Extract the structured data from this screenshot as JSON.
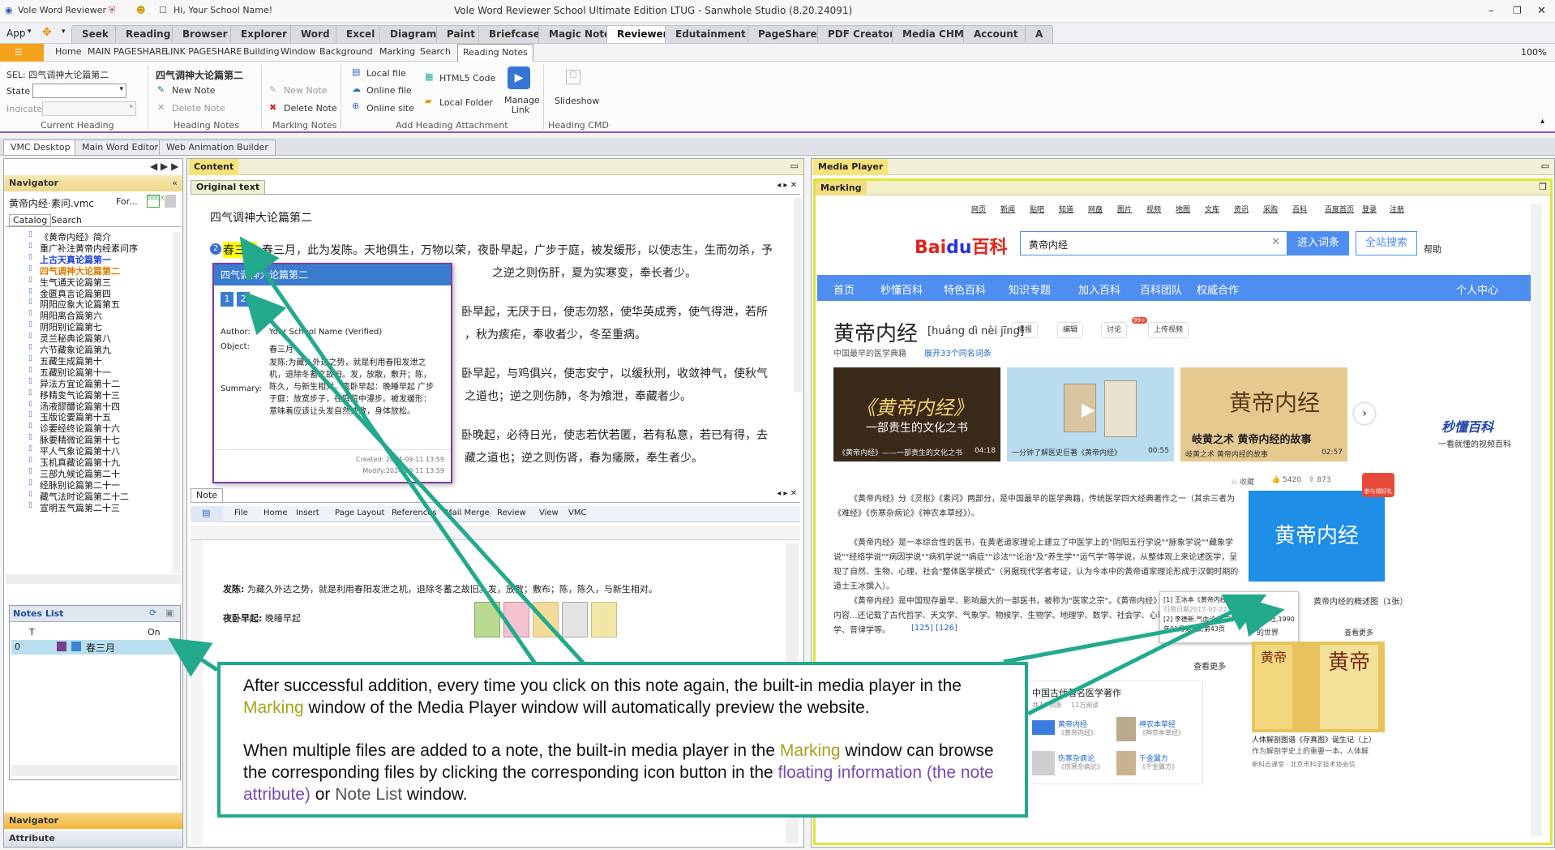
{
  "titlebar": {
    "app_name": "Vole Word Reviewer",
    "greeting": "Hi, Your School Name!",
    "title": "Vole Word Reviewer School Ultimate Edition LTUG - Sanwhole Studio (8.20.24091)"
  },
  "app_menu": "App",
  "ribbon_tabs": [
    "Seek",
    "Reading",
    "Browser",
    "Explorer",
    "Word",
    "Excel",
    "Diagram",
    "Paint",
    "Briefcase",
    "Magic Note",
    "Reviewer",
    "Edutainment",
    "PageShare",
    "PDF Creator",
    "Media CHM",
    "Account",
    "A"
  ],
  "active_tab": "Reviewer",
  "sub_tabs": [
    "Home",
    "MAIN PAGESHARE",
    "LINK PAGESHARE",
    "Building",
    "Window",
    "Background",
    "Marking",
    "Search",
    "Reading Notes"
  ],
  "zoom": "100%",
  "ribbon": {
    "sel_label": "SEL: 四气调神大论篇第二",
    "state_label": "State",
    "indicate_label": "Indicate",
    "group_current_heading": "Current Heading",
    "heading_title": "四气调神大论篇第二",
    "new_note": "New Note",
    "delete_note": "Delete Note",
    "group_heading_notes": "Heading Notes",
    "new_note2": "New Note",
    "delete_note2": "Delete Note",
    "group_marking_notes": "Marking Notes",
    "local_file": "Local file",
    "online_file": "Online file",
    "online_site": "Online site",
    "html5_code": "HTML5 Code",
    "local_folder": "Local Folder",
    "manage_link": "Manage Link",
    "group_add_attachment": "Add Heading Attachment",
    "slideshow": "Slideshow",
    "group_heading_cmd": "Heading CMD"
  },
  "panel_tabs": [
    "VMC Desktop",
    "Main Word Editor",
    "Web Animation Builder"
  ],
  "navigator": {
    "title": "Navigator",
    "file": "黄帝内经·素问.vmc",
    "file_extra": "For...",
    "tabs": [
      "Catalog",
      "Search"
    ],
    "items": [
      "《黄帝内经》简介",
      "重广补注黄帝内经素问序",
      "上古天真论篇第一",
      "四气调神大论篇第二",
      "生气通天论篇第三",
      "金匮真言论篇第四",
      "阴阳应象大论篇第五",
      "阴阳离合篇第六",
      "阴阳别论篇第七",
      "灵兰秘典论篇第八",
      "六节藏象论篇第九",
      "五藏生成篇第十",
      "五藏别论篇第十一",
      "异法方宜论篇第十二",
      "移精变气论篇第十三",
      "汤液醪醴论篇第十四",
      "玉版论要篇第十五",
      "诊要经终论篇第十六",
      "脉要精微论篇第十七",
      "平人气象论篇第十八",
      "玉机真藏论篇第十九",
      "三部九候论篇第二十",
      "经脉别论篇第二十一",
      "藏气法时论篇第二十二",
      "宣明五气篇第二十三"
    ]
  },
  "notes_list": {
    "title": "Notes List",
    "col_t": "T",
    "col_on": "On",
    "row_index": "0",
    "row_label": "春三月"
  },
  "bottom_bars": [
    "Navigator",
    "Attribute"
  ],
  "content": {
    "title": "Content",
    "original_tab": "Original text",
    "heading": "四气调神大论篇第二",
    "paragraphs": [
      "春三月，此为发陈。天地俱生，万物以荣，夜卧早起，广步于庭，被发缓形，以使志生，生而勿杀，予",
      "之逆之则伤肝，夏为实寒变，奉长者少。",
      "卧早起，无厌于日，使志勿怒，使华英成秀，使气得泄，若所",
      "，秋为痎疟，奉收者少，冬至重病。",
      "卧早起，与鸡俱兴，使志安宁，以缓秋刑，收敛神气，使秋气",
      "之道也；逆之则伤肺，冬为飧泄，奉藏者少。",
      "卧晚起，必待日光，使志若伏若匿，若有私意，若已有得，去",
      "藏之道也；逆之则伤肾，春为痿厥，奉生者少。"
    ],
    "highlight": "春三月",
    "note_tab": "Note",
    "note_menu": [
      "File",
      "Home",
      "Insert",
      "Page Layout",
      "References",
      "Mail Merge",
      "Review",
      "View",
      "VMC"
    ],
    "note_line1_bold": "发陈:",
    "note_line1": "为藏久外达之势，就是利用春阳发泄之机，退除冬蓄之故旧。发，放散；敷布；陈，陈久，与新生相对。",
    "note_line2_bold": "夜卧早起:",
    "note_line2": "晚睡早起"
  },
  "popup": {
    "title": "四气调神大论篇第二",
    "btn1": "1",
    "btn2": "2",
    "author_label": "Author:",
    "author": "Your School Name (Verified)",
    "object_label": "Object:",
    "object": "春三月",
    "summary_label": "Summary:",
    "summary": "发陈:为藏久外达之势，就是利用春阳发泄之机，退除冬蓄之故旧。发，放散，敷开；陈，陈久，与新生相对。夜卧早起：晚睡早起 广步于庭：放宽步子，在庭院中漫步。被发缓形：意味着应该让头发自然披散，身体放松。",
    "created": "Created: 2024-09-11 13:59",
    "modified": "Modify:2024-09-11 13:59"
  },
  "media": {
    "title": "Media Player",
    "marking_tab": "Marking",
    "top_links": [
      "网页",
      "新闻",
      "贴吧",
      "知道",
      "网盘",
      "图片",
      "视频",
      "地图",
      "文库",
      "资讯",
      "采购",
      "百科",
      "百度首页",
      "登录",
      "注册"
    ],
    "search_value": "黄帝内经",
    "btn_enter": "进入词条",
    "btn_all": "全站搜索",
    "help": "帮助",
    "nav": [
      "首页",
      "秒懂百科",
      "特色百科",
      "知识专题",
      "加入百科",
      "百科团队",
      "权威合作",
      "个人中心"
    ],
    "entry_title": "黄帝内经",
    "pinyin": "[huáng dì nèi jīng]",
    "actions": [
      "播报",
      "编辑",
      "讨论",
      "上传视频"
    ],
    "discuss_badge": "99+",
    "subtitle": "中国最早的医学典籍",
    "expand": "展开33个同名词条",
    "video1_big": "《黄帝内经》",
    "video1_sub": "一部贵生的文化之书",
    "video1_cap": "《黄帝内经》——一部贵生的文化之书",
    "video1_time": "04:18",
    "video2_cap": "一分钟了解医史巨著《黄帝内经》",
    "video2_time": "00:55",
    "video3_big": "黄帝内经",
    "video3_sub": "岐黄之术 黄帝内经的故事",
    "video3_cap": "岐黄之术 黄帝内经的故事",
    "video3_time": "02:57",
    "brand": "秒懂百科",
    "brand_sub": "一看就懂的视频百科",
    "stats_collect": "收藏",
    "stats_likes": "5420",
    "stats_share": "873",
    "para1": "《黄帝内经》分《灵枢》《素问》两部分，是中国最早的医学典籍，传统医学四大经典著作之一（其余三者为《难经》《伤寒杂病论》《神农本草经》）。",
    "para2": "《黄帝内经》是一本综合性的医书，在黄老道家理论上建立了中医学上的\"阴阳五行学说\"\"脉象学说\"\"藏象学说\"\"经络学说\"\"病因学说\"\"病机学说\"\"病症\"\"诊法\"\"论治\"及\"养生学\"\"运气学\"等学说，从整体观上来论述医学，呈现了自然、生物、心理、社会\"整体医学模式\"（另据现代学者考证，认为今本中的黄帝道家理论形成于汉朝时期的道士王冰撰入）。",
    "para3": "《黄帝内经》是中国现存最早、影响最大的一部医书，被称为\"医家之宗\"。《黄帝内经》的内容...还记载了古代哲学、天文学、气象学、物候学、生物学、地理学、数学、社会学、心理学、音律学等。",
    "refs": "[125] [126]",
    "ref_popup1": "[1] 王冰本《黄帝内经》 . 豆丁网",
    "ref_popup2": "引用日期2017-02-22",
    "ref_popup3": "[2] 李德新.气血论.辽宁科学技术出版社,1990年01月第1版,第43页",
    "side_banner": "黄帝内经",
    "side_caption": "黄帝内经的概述图（1张）",
    "more": "查看更多",
    "famous": "中国古代著名医学著作",
    "famous_stats1": "共7个词条",
    "famous_stats2": "11万阅读",
    "book1": "黄帝内经",
    "book1_sub": "《黄帝内经》",
    "book2": "神农本草经",
    "book2_sub": "《神农本草经》",
    "book3": "伤寒杂病论",
    "book3_sub": "《伤寒杂病论》",
    "book4": "千金翼方",
    "book4_sub": "《千金翼方》",
    "world_label": "的世界",
    "more2": "查看更多",
    "side_book_title": "人体解剖图谱《存真图》诞生记（上）",
    "side_book_sub": "作为解剖学史上的重要一本，人体解",
    "side_book_meta": "新科云课堂 · 北京市科学技术协会信",
    "gift": "参与领好礼"
  },
  "callout": {
    "p1_a": "After successful addition, every time you click on this note again, the built-in media player in the ",
    "p1_marking": "Marking",
    "p1_b": " window of the Media Player window will automatically preview the website.",
    "p2_a": "When multiple files are added to a note, the built-in media player in the ",
    "p2_marking": "Marking",
    "p2_b": " window can browse the corresponding files by clicking the corresponding icon button in the ",
    "p2_floating": "floating information (the note attribute)",
    "p2_c": " or ",
    "p2_notelist": "Note List",
    "p2_d": " window."
  },
  "colors": {
    "accent_purple": "#7a3ea6",
    "callout_green": "#23a98c",
    "baidu_blue": "#4e8ef1",
    "highlight_yellow": "#ffff00"
  }
}
